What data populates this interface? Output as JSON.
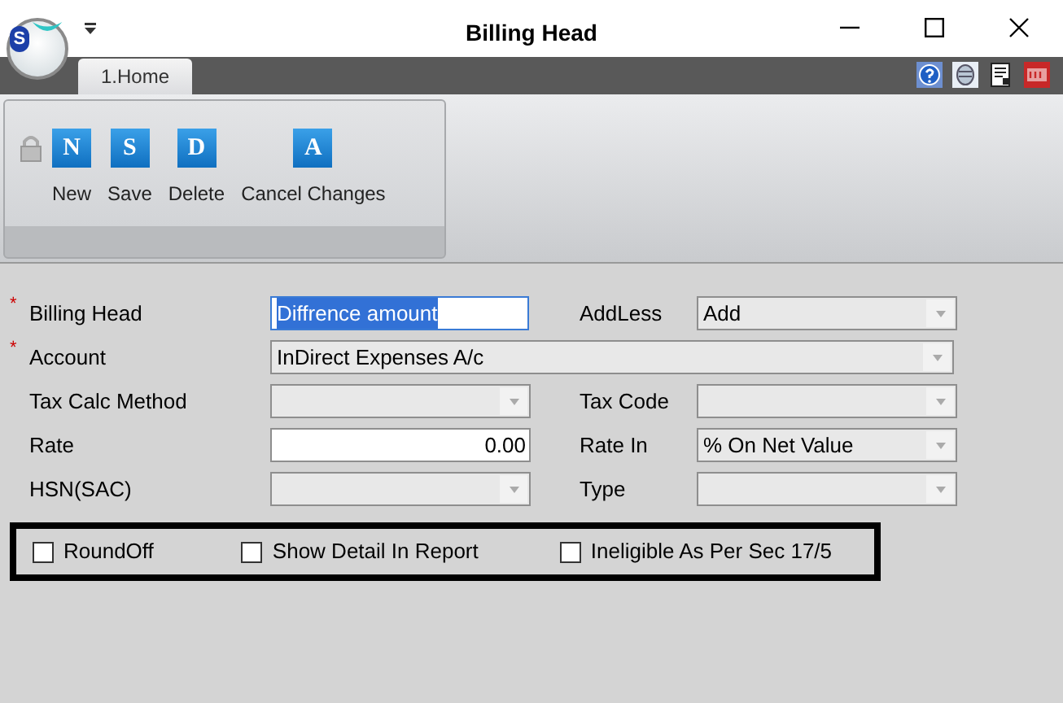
{
  "window": {
    "title": "Billing Head",
    "logo_letter": "S"
  },
  "tabs": [
    {
      "label": "1.Home",
      "selected": true
    }
  ],
  "ribbon": {
    "locked": true,
    "buttons": [
      {
        "label": "New",
        "glyph": "N"
      },
      {
        "label": "Save",
        "glyph": "S"
      },
      {
        "label": "Delete",
        "glyph": "D"
      },
      {
        "label": "Cancel Changes",
        "glyph": "A"
      }
    ]
  },
  "form": {
    "rows": [
      {
        "left": {
          "label": "Billing Head",
          "required_mark": "*",
          "kind": "text",
          "value": "Diffrence amount",
          "selected": true
        },
        "right": {
          "label": "AddLess",
          "kind": "combo",
          "value": "Add"
        }
      },
      {
        "left": {
          "label": "Account",
          "required_mark": "*",
          "kind": "combo",
          "value": "InDirect Expenses A/c"
        }
      },
      {
        "left": {
          "label": "Tax Calc Method",
          "kind": "combo"
        },
        "right": {
          "label": "Tax Code",
          "kind": "combo"
        }
      },
      {
        "left": {
          "label": "Rate",
          "kind": "number",
          "value": "0.00"
        },
        "right": {
          "label": "Rate In",
          "kind": "combo",
          "value": "% On Net Value"
        }
      },
      {
        "left": {
          "label": "HSN(SAC)",
          "kind": "combo"
        },
        "right": {
          "label": "Type",
          "kind": "combo"
        }
      }
    ],
    "checkboxes": [
      {
        "label": "RoundOff",
        "checked": false
      },
      {
        "label": "Show Detail In Report",
        "checked": false
      },
      {
        "label": "Ineligible As Per Sec 17/5",
        "checked": false
      }
    ]
  }
}
